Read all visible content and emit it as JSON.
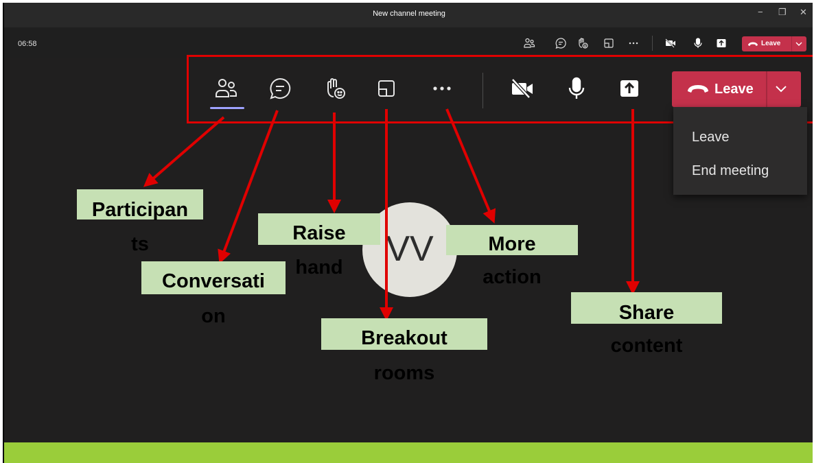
{
  "window": {
    "title": "New channel meeting",
    "minimize_glyph": "−",
    "restore_glyph": "❐",
    "close_glyph": "✕"
  },
  "meeting": {
    "timer": "06:58"
  },
  "toolbar": {
    "leave_label": "Leave",
    "icons": [
      "participants-icon",
      "chat-icon",
      "raise-hand-icon",
      "breakout-rooms-icon",
      "more-icon",
      "camera-off-icon",
      "mic-icon",
      "share-icon",
      "phone-icon",
      "chevron-down-icon"
    ]
  },
  "leave_menu": {
    "items": [
      "Leave",
      "End meeting"
    ]
  },
  "participant": {
    "initials": "VV"
  },
  "annotations": {
    "participants": {
      "line1": "Participan",
      "line2": "ts"
    },
    "conversation": {
      "line1": "Conversati",
      "line2": "on"
    },
    "raise_hand": {
      "line1": "Raise",
      "line2": "hand"
    },
    "breakout_rooms": {
      "line1": "Breakout",
      "line2": "rooms"
    },
    "more_action": {
      "line1": "More",
      "line2": "action"
    },
    "share_content": {
      "line1": "Share",
      "line2": "content"
    }
  },
  "colors": {
    "background": "#201f1f",
    "titlebar": "#292929",
    "leave_red": "#c4314b",
    "highlight_red": "#e00000",
    "callout_green": "#c6e0b4",
    "bottom_bar": "#9acd3a",
    "accent": "#9ea2ff"
  }
}
